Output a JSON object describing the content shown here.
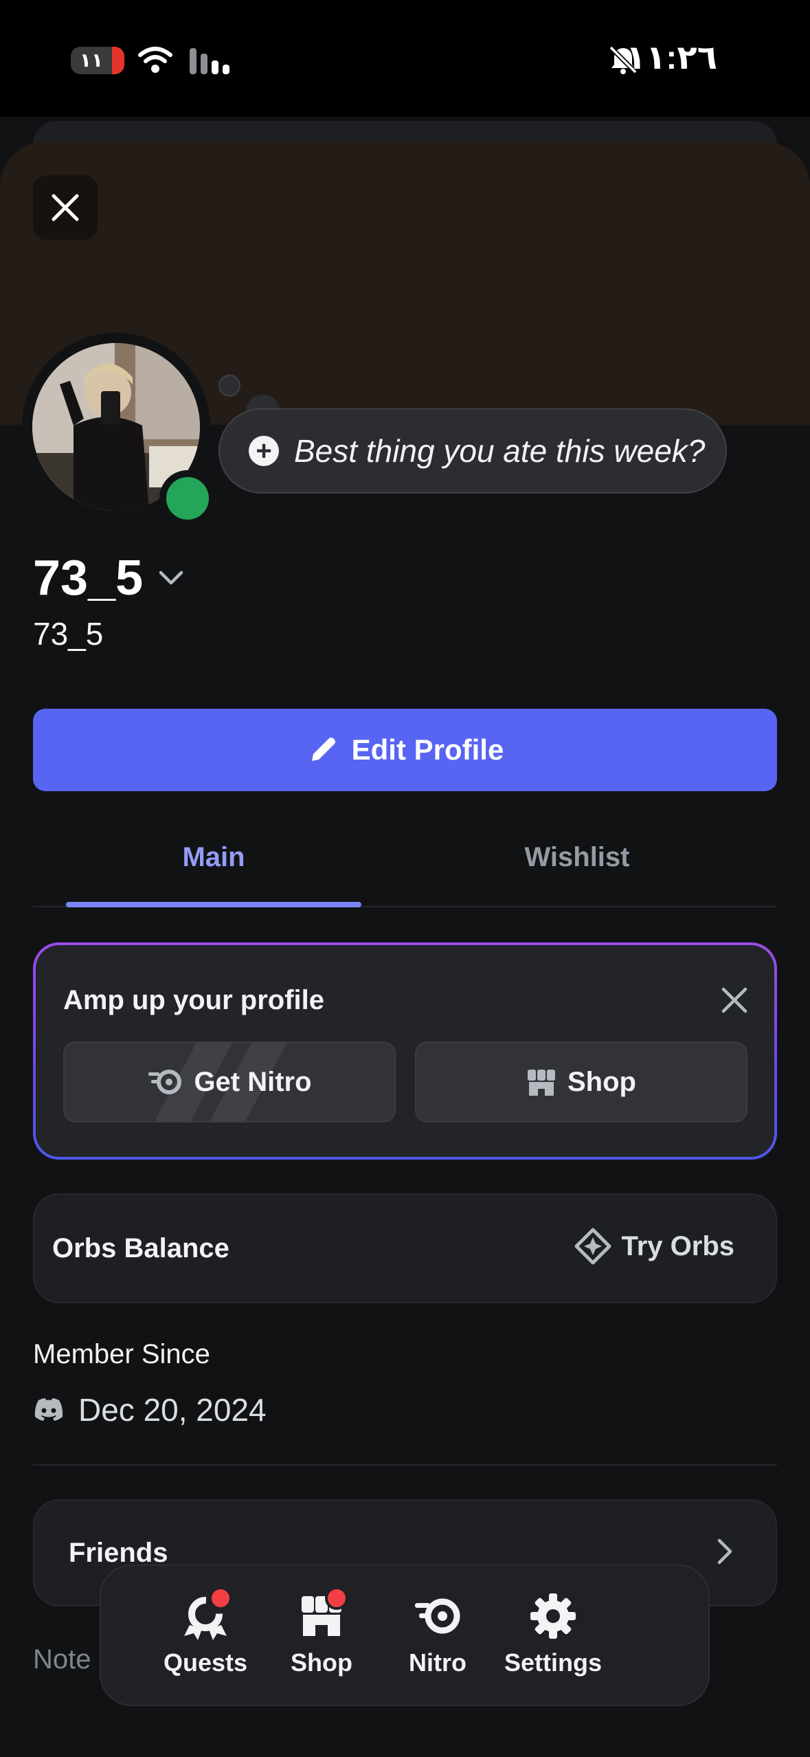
{
  "status_bar": {
    "battery_text": "١١",
    "time": "١١:٢٦"
  },
  "profile": {
    "status_prompt": "Best thing you ate this week?",
    "display_name": "73_5",
    "username": "73_5",
    "online_color": "#23a55a"
  },
  "actions": {
    "edit_profile_label": "Edit Profile"
  },
  "tabs": [
    {
      "label": "Main",
      "selected": true
    },
    {
      "label": "Wishlist",
      "selected": false
    }
  ],
  "amp_card": {
    "title": "Amp up your profile",
    "get_nitro_label": "Get Nitro",
    "shop_label": "Shop"
  },
  "orbs": {
    "label": "Orbs Balance",
    "try_label": "Try Orbs"
  },
  "member_since": {
    "label": "Member Since",
    "date": "Dec 20, 2024"
  },
  "friends": {
    "label": "Friends"
  },
  "note": {
    "label": "Note"
  },
  "bottom_nav": [
    {
      "label": "Quests",
      "icon": "quests-icon",
      "badge": true
    },
    {
      "label": "Shop",
      "icon": "shop-icon",
      "badge": true
    },
    {
      "label": "Nitro",
      "icon": "nitro-icon",
      "badge": false
    },
    {
      "label": "Settings",
      "icon": "gear-icon",
      "badge": false
    }
  ],
  "colors": {
    "accent": "#5865f2",
    "tab_selected": "#949cf7",
    "background": "#111214",
    "badge": "#f23f43"
  }
}
